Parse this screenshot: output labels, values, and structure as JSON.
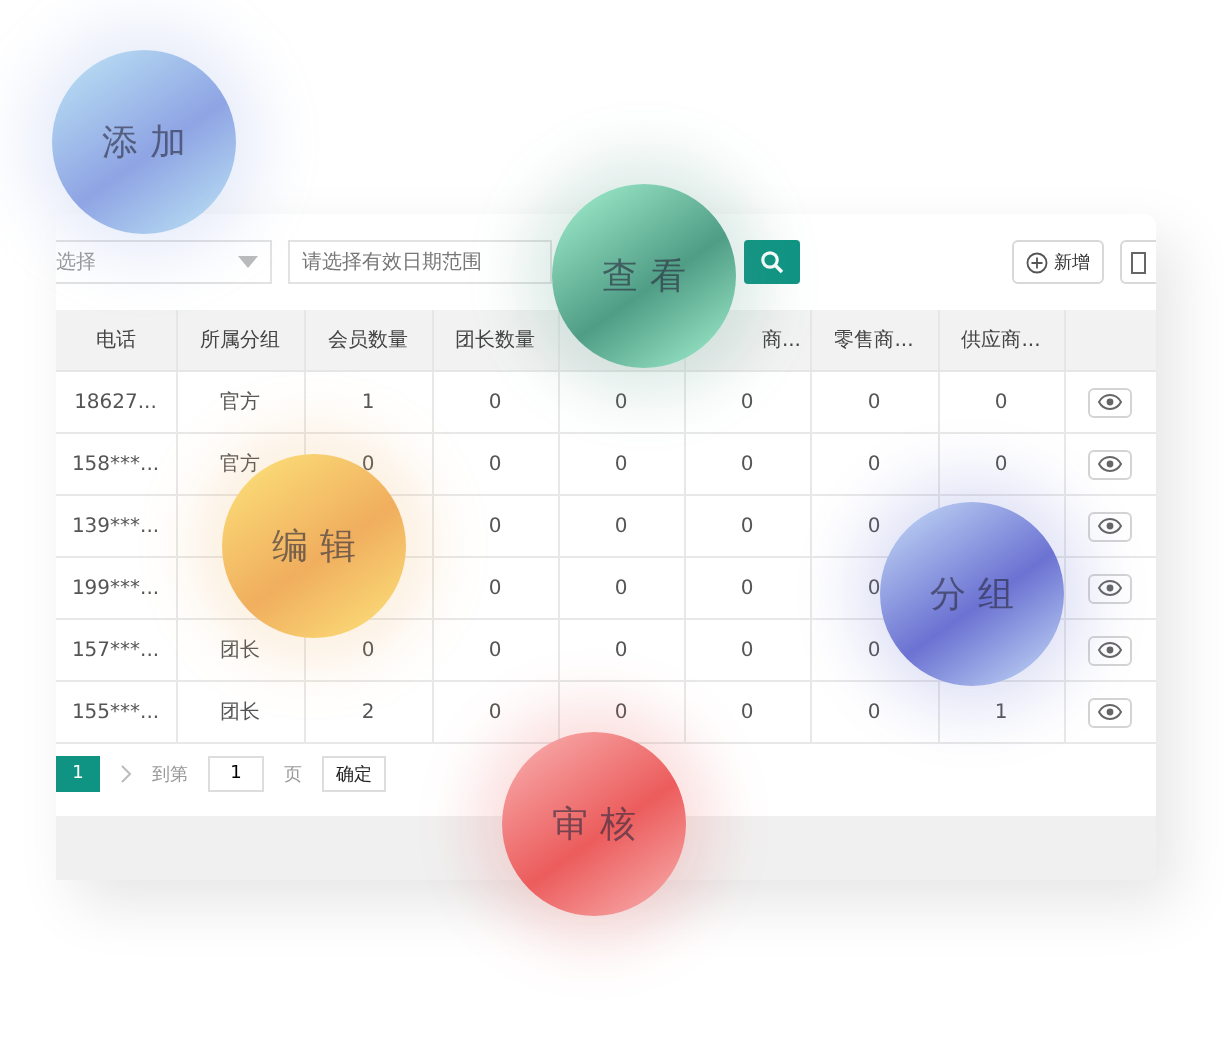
{
  "toolbar": {
    "select": {
      "placeholder": "选择"
    },
    "date_range": {
      "placeholder": "请选择有效日期范围"
    },
    "add_button": "新增"
  },
  "table": {
    "columns": [
      "电话",
      "所属分组",
      "会员数量",
      "团长数量",
      null,
      "商...",
      "零售商...",
      "供应商...",
      null
    ],
    "rows": [
      {
        "cells": [
          "18627...",
          "官方",
          "1",
          "0",
          "0",
          "0",
          "0",
          "0"
        ]
      },
      {
        "cells": [
          "158***...",
          "官方",
          "0",
          "0",
          "0",
          "0",
          "0",
          "0"
        ]
      },
      {
        "cells": [
          "139***...",
          null,
          null,
          "0",
          "0",
          "0",
          "0",
          null
        ]
      },
      {
        "cells": [
          "199***...",
          null,
          null,
          "0",
          "0",
          "0",
          "0",
          null
        ]
      },
      {
        "cells": [
          "157***...",
          "团长",
          "0",
          "0",
          "0",
          "0",
          "0",
          null
        ]
      },
      {
        "cells": [
          "155***...",
          "团长",
          "2",
          "0",
          "0",
          "0",
          "0",
          "1"
        ]
      }
    ]
  },
  "pagination": {
    "pages": [
      {
        "label": "1",
        "selected": true
      }
    ],
    "goto_label": "到第",
    "page_input": "1",
    "page_unit": "页",
    "confirm": "确定"
  },
  "bubbles": [
    {
      "label": "添加",
      "color": "#8ea4e4"
    },
    {
      "label": "查看",
      "color": "#4f9d85"
    },
    {
      "label": "编辑",
      "color": "#f0ae5e"
    },
    {
      "label": "分组",
      "color": "#6b72d2"
    },
    {
      "label": "审核",
      "color": "#ec5c5c"
    }
  ]
}
